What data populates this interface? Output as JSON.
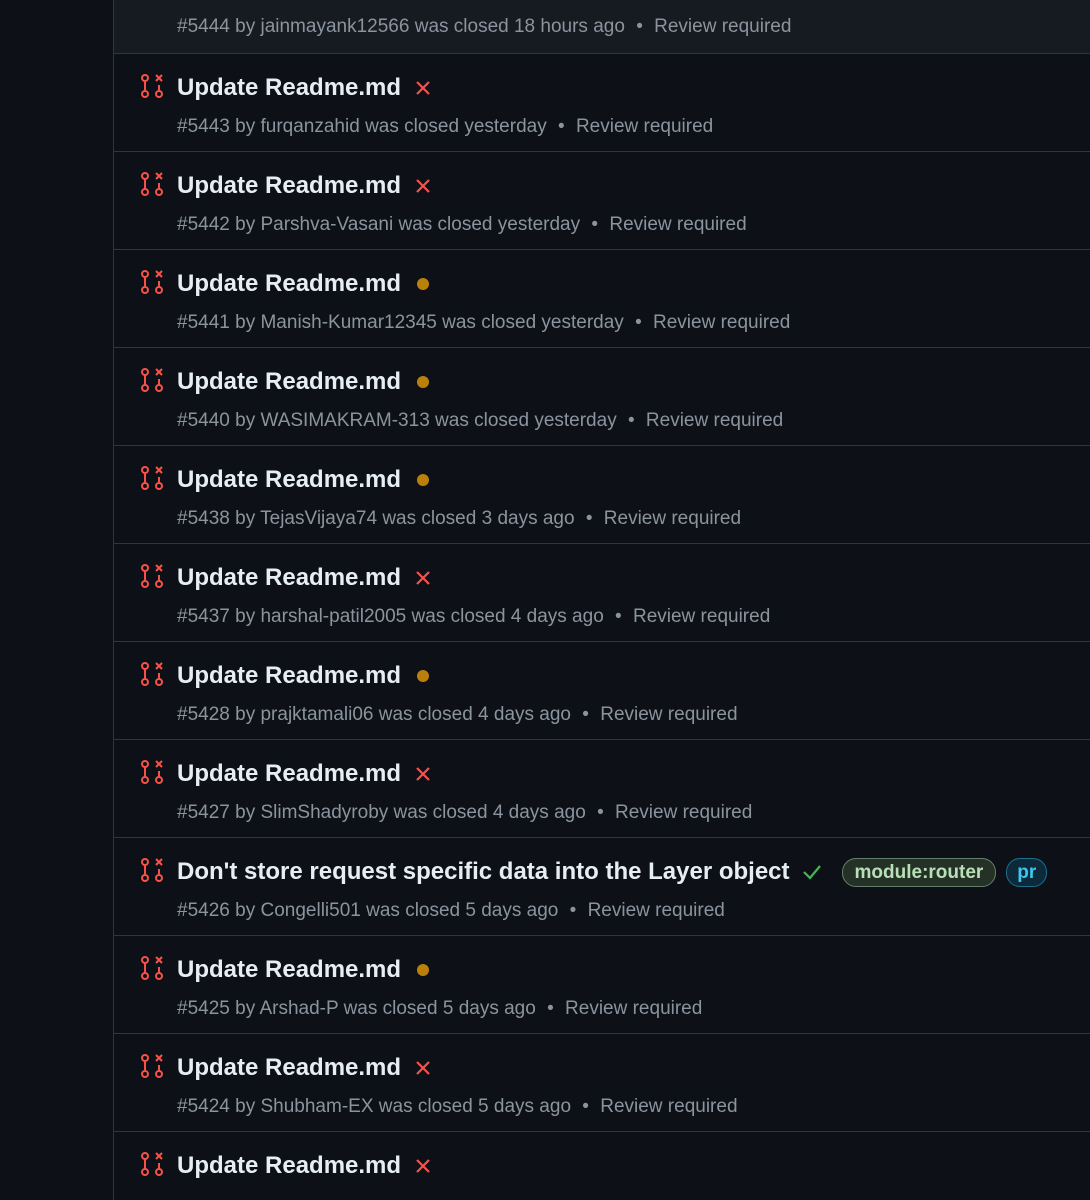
{
  "colors": {
    "background": "#0d1117",
    "border": "#30363d",
    "title": "#e6edf3",
    "meta": "#8b949e",
    "closed_icon": "#f85149",
    "failure": "#f85149",
    "pending": "#bb8009",
    "success": "#3fb950"
  },
  "pulls": [
    {
      "number": "#5444",
      "author": "jainmayank12566",
      "closed": "was closed 18 hours ago",
      "review": "Review required"
    },
    {
      "title": "Update Readme.md",
      "status": "failure-x-icon",
      "number": "#5443",
      "author": "furqanzahid",
      "closed": "was closed yesterday",
      "review": "Review required"
    },
    {
      "title": "Update Readme.md",
      "status": "failure-x-icon",
      "number": "#5442",
      "author": "Parshva-Vasani",
      "closed": "was closed yesterday",
      "review": "Review required"
    },
    {
      "title": "Update Readme.md",
      "status": "pending-dot-icon",
      "number": "#5441",
      "author": "Manish-Kumar12345",
      "closed": "was closed yesterday",
      "review": "Review required"
    },
    {
      "title": "Update Readme.md",
      "status": "pending-dot-icon",
      "number": "#5440",
      "author": "WASIMAKRAM-313",
      "closed": "was closed yesterday",
      "review": "Review required"
    },
    {
      "title": "Update Readme.md",
      "status": "pending-dot-icon",
      "number": "#5438",
      "author": "TejasVijaya74",
      "closed": "was closed 3 days ago",
      "review": "Review required"
    },
    {
      "title": "Update Readme.md",
      "status": "failure-x-icon",
      "number": "#5437",
      "author": "harshal-patil2005",
      "closed": "was closed 4 days ago",
      "review": "Review required"
    },
    {
      "title": "Update Readme.md",
      "status": "pending-dot-icon",
      "number": "#5428",
      "author": "prajktamali06",
      "closed": "was closed 4 days ago",
      "review": "Review required"
    },
    {
      "title": "Update Readme.md",
      "status": "failure-x-icon",
      "number": "#5427",
      "author": "SlimShadyroby",
      "closed": "was closed 4 days ago",
      "review": "Review required"
    },
    {
      "title": "Don't store request specific data into the Layer object",
      "status": "success-check-icon",
      "labels": [
        "module:router",
        "pr"
      ],
      "number": "#5426",
      "author": "Congelli501",
      "closed": "was closed 5 days ago",
      "review": "Review required"
    },
    {
      "title": "Update Readme.md",
      "status": "pending-dot-icon",
      "number": "#5425",
      "author": "Arshad-P",
      "closed": "was closed 5 days ago",
      "review": "Review required"
    },
    {
      "title": "Update Readme.md",
      "status": "failure-x-icon",
      "number": "#5424",
      "author": "Shubham-EX",
      "closed": "was closed 5 days ago",
      "review": "Review required"
    },
    {
      "title": "Update Readme.md",
      "status": "failure-x-icon"
    }
  ],
  "meta_words": {
    "by": "by",
    "sep": "•"
  }
}
